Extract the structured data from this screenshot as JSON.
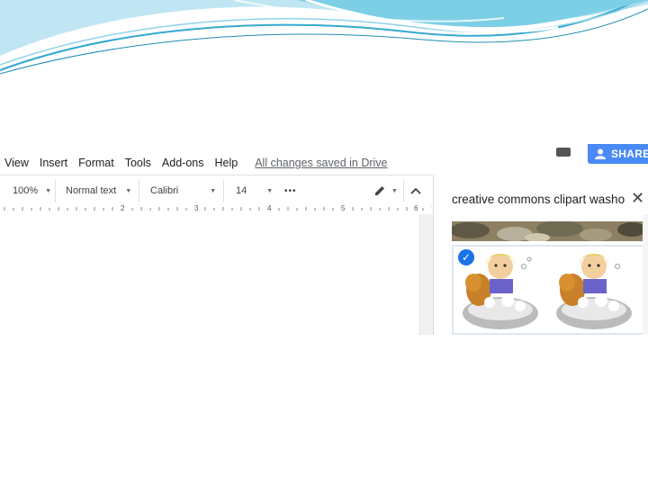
{
  "menu": {
    "items": [
      "View",
      "Insert",
      "Format",
      "Tools",
      "Add-ons",
      "Help"
    ],
    "saved_status": "All changes saved in Drive"
  },
  "header": {
    "share_label": "SHARE"
  },
  "toolbar": {
    "zoom": "100%",
    "style": "Normal text",
    "font": "Calibri",
    "size": "14",
    "more": "•••"
  },
  "ruler": {
    "numbers": [
      "2",
      "3",
      "4",
      "5",
      "6"
    ]
  },
  "panel": {
    "search_text": "creative commons clipart washo",
    "close_icon": "close-icon",
    "selected_icon": "check-icon"
  },
  "colors": {
    "share_blue": "#4a8af4",
    "check_blue": "#1a73e8",
    "swoosh_cyan": "#36b6d6"
  },
  "icons": [
    "pencil-icon",
    "chevron-up-icon",
    "close-icon",
    "check-icon",
    "person-icon"
  ]
}
